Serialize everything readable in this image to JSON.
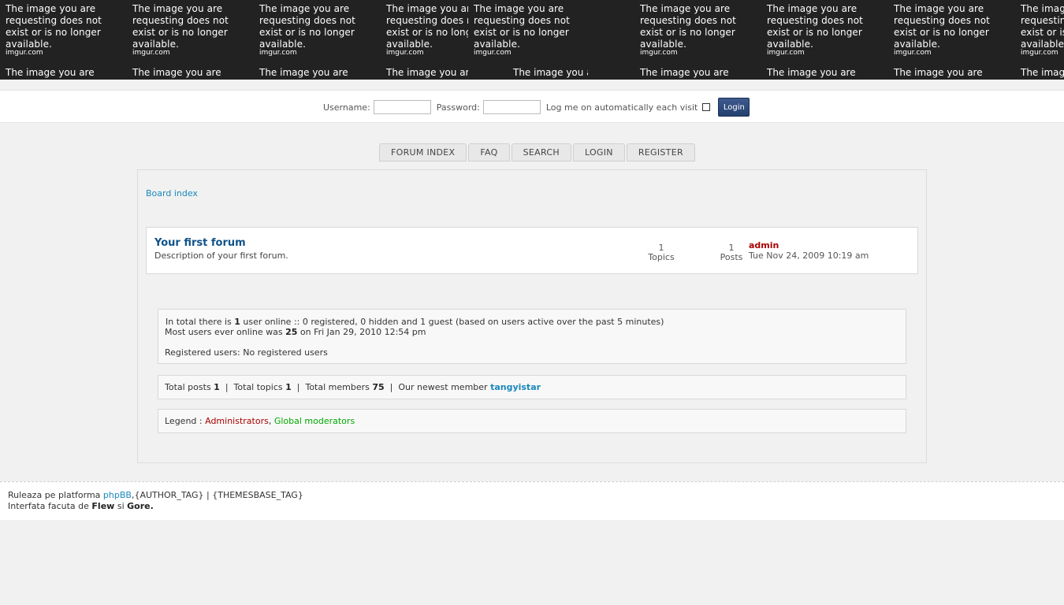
{
  "banner": {
    "tiles": [
      {
        "msg": "The image you are requesting does not exist or is no longer available.",
        "site": "imgur.com",
        "msg2": "The image you are"
      },
      {
        "msg": "The image you are requesting does not exist or is no longer available.",
        "site": "imgur.com",
        "msg2": "The image you are"
      },
      {
        "msg": "The image you are requesting does not exist or is no longer available.",
        "site": "imgur.com",
        "msg2": "The image you are"
      },
      {
        "msg": "The image you are requesting does not exist or is no longer available.",
        "site": "imgur.com",
        "msg2": "The image you are"
      },
      {
        "msg": "The image you are requesting does not exist or is no longer available.",
        "site": "imgur.com",
        "msg2": "The image you are"
      },
      {
        "msg": "The image you are requesting does not exist or is no longer available.",
        "site": "imgur.com",
        "msg2": "The image you are"
      },
      {
        "msg": "The image you are requesting does not exist or is no longer available.",
        "site": "imgur.com",
        "msg2": "The image you are"
      },
      {
        "msg": "The image you are requesting does not exist or is no longer available.",
        "site": "imgur.com",
        "msg2": "The image you are"
      },
      {
        "msg": "The image you are requesting does not exist or is no longer available.",
        "site": "imgur.com",
        "msg2": "The image you are"
      }
    ]
  },
  "login": {
    "username_label": "Username:",
    "username_value": "",
    "password_label": "Password:",
    "password_value": "",
    "autologin_label": "Log me on automatically each visit",
    "autologin_checked": false,
    "button_label": "Login"
  },
  "nav": {
    "tabs": [
      {
        "label": "FORUM INDEX"
      },
      {
        "label": "FAQ"
      },
      {
        "label": "SEARCH"
      },
      {
        "label": "LOGIN"
      },
      {
        "label": "REGISTER"
      }
    ]
  },
  "breadcrumb": "Board index",
  "forum": {
    "title": "Your first forum",
    "description": "Description of your first forum.",
    "topics_count": "1",
    "topics_label": "Topics",
    "posts_count": "1",
    "posts_label": "Posts",
    "last_post_author": "admin",
    "last_post_time": "Tue Nov 24, 2009 10:19 am"
  },
  "online": {
    "line1_prefix": "In total there is ",
    "line1_count": "1",
    "line1_suffix": " user online :: 0 registered, 0 hidden and 1 guest (based on users active over the past 5 minutes)",
    "line2_prefix": "Most users ever online was ",
    "line2_count": "25",
    "line2_suffix": " on Fri Jan 29, 2010 12:54 pm",
    "registered_users": "Registered users: No registered users"
  },
  "stats": {
    "total_posts_label": "Total posts ",
    "total_posts": "1",
    "total_topics_label": "Total topics ",
    "total_topics": "1",
    "total_members_label": "Total members ",
    "total_members": "75",
    "newest_label": "Our newest member ",
    "newest_member": "tangyistar",
    "separator": "|"
  },
  "legend": {
    "label": "Legend : ",
    "administrators": "Administrators",
    "comma": ",",
    "global_moderators": "Global moderators"
  },
  "footer": {
    "line1_prefix": "Ruleaza pe platforma ",
    "line1_link": "phpBB",
    "line1_suffix": ",{AUTHOR_TAG} | {THEMESBASE_TAG}",
    "line2_prefix": "Interfata facuta de ",
    "line2_name1": "Flew",
    "line2_mid": " si ",
    "line2_name2": "Gore."
  },
  "colors": {
    "link": "#1a88bb",
    "forum_title": "#105289",
    "admin": "#aa0000",
    "global_moderator": "#00aa00",
    "banner_bg": "#222222"
  }
}
